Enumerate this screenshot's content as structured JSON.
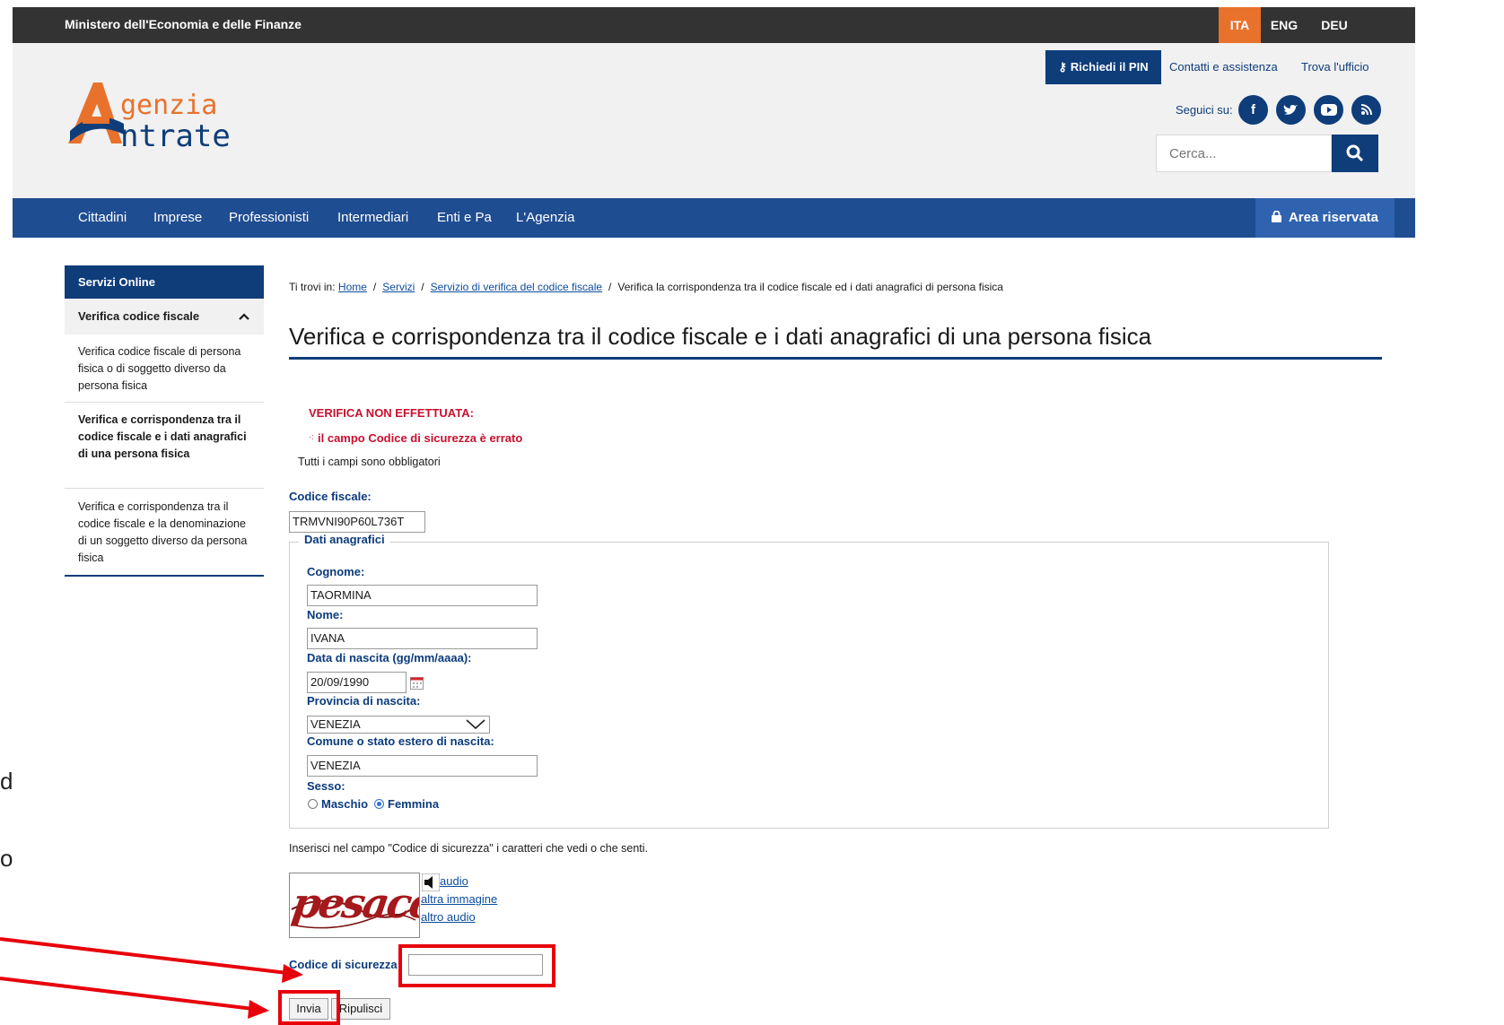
{
  "topbar": {
    "ministry": "Ministero dell'Economia e delle Finanze",
    "languages": [
      "ITA",
      "ENG",
      "DEU"
    ],
    "active_language": "ITA"
  },
  "header": {
    "logo_line1": "genzia",
    "logo_line2": "ntrate",
    "pin_button": "Richiedi il PIN",
    "contacts": "Contatti e assistenza",
    "office": "Trova l'ufficio",
    "follow": "Seguici su:",
    "search_placeholder": "Cerca..."
  },
  "nav": {
    "items": [
      "Cittadini",
      "Imprese",
      "Professionisti",
      "Intermediari",
      "Enti e Pa",
      "L'Agenzia"
    ],
    "reserved": "Area riservata"
  },
  "sidebar": {
    "header": "Servizi Online",
    "section": "Verifica codice fiscale",
    "items": [
      {
        "label": "Verifica codice fiscale di persona fisica o di soggetto diverso da persona fisica",
        "active": false
      },
      {
        "label": "Verifica e corrispondenza tra il codice fiscale e i dati anagrafici di una persona fisica",
        "active": true
      },
      {
        "label": "Verifica e corrispondenza tra il codice fiscale e la denominazione di un soggetto diverso da persona fisica",
        "active": false
      }
    ]
  },
  "breadcrumb": {
    "prefix": "Ti trovi in:",
    "home": "Home",
    "servizi": "Servizi",
    "servizio": "Servizio di verifica del codice fiscale",
    "current": "Verifica la corrispondenza tra il codice fiscale ed i dati anagrafici di persona fisica"
  },
  "page_title": "Verifica e corrispondenza tra il codice fiscale e i dati anagrafici di una persona fisica",
  "messages": {
    "error_title": "VERIFICA NON EFFETTUATA:",
    "error_detail": "il campo Codice di sicurezza è errato",
    "required": "Tutti i campi sono obbligatori"
  },
  "form": {
    "codice_fiscale_label": "Codice fiscale:",
    "codice_fiscale_value": "TRMVNI90P60L736T",
    "fieldset_legend": "Dati anagrafici",
    "cognome_label": "Cognome:",
    "cognome_value": "TAORMINA",
    "nome_label": "Nome:",
    "nome_value": "IVANA",
    "nascita_label": "Data di nascita (gg/mm/aaaa):",
    "nascita_value": "20/09/1990",
    "provincia_label": "Provincia di nascita:",
    "provincia_value": "VENEZIA",
    "comune_label": "Comune o stato estero di nascita:",
    "comune_value": "VENEZIA",
    "sesso_label": "Sesso:",
    "sesso_options": [
      "Maschio",
      "Femmina"
    ],
    "sesso_selected": "Femmina",
    "captcha_instruction": "Inserisci nel campo \"Codice di sicurezza\" i caratteri che vedi o che senti.",
    "captcha_text": "pesaccu",
    "captcha_audio": "audio",
    "captcha_new_image": "altra immagine",
    "captcha_new_audio": "altro audio",
    "security_label": "Codice di sicurezza",
    "security_value": "",
    "submit_label": "Invia",
    "reset_label": "Ripulisci"
  },
  "annotation": {
    "color": "#e8000b",
    "left_text": [
      "d",
      "o"
    ]
  },
  "colors": {
    "navy": "#0e3d7a",
    "nav_blue": "#1f4d91",
    "orange": "#e8722c",
    "error_red": "#c8102e"
  }
}
